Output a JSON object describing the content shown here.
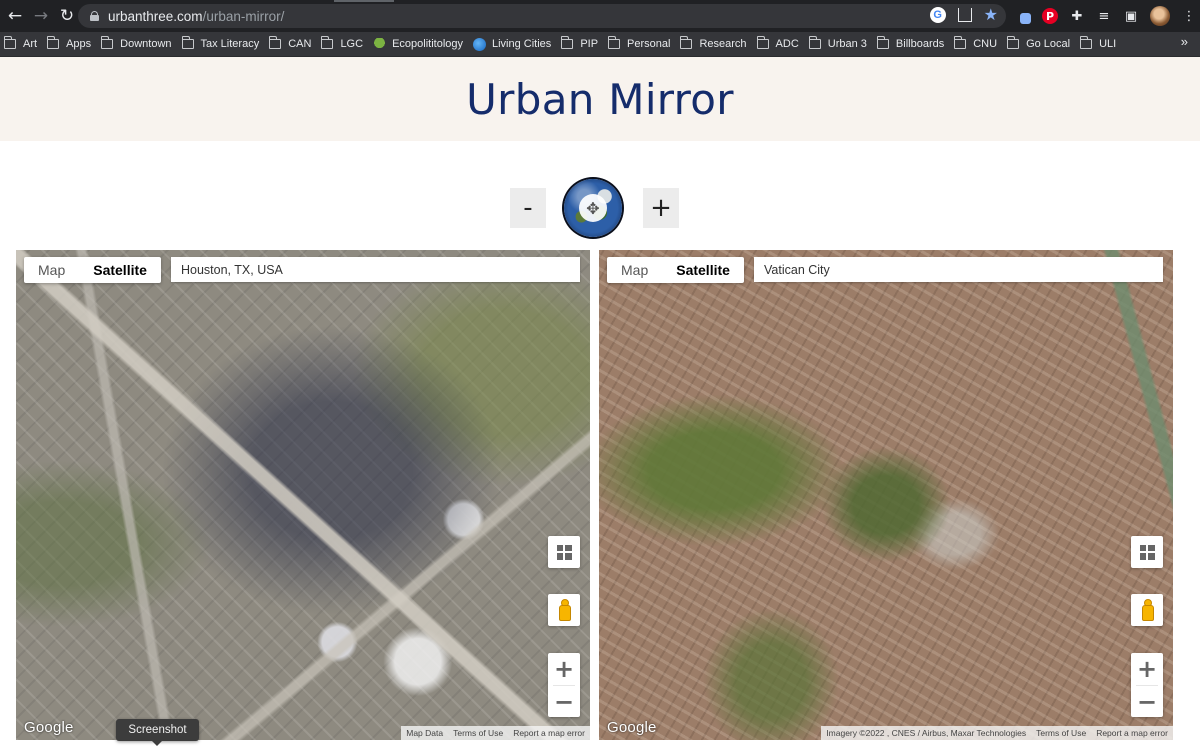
{
  "browser": {
    "url_host": "urbanthree.com",
    "url_path": "/urban-mirror/",
    "bookmarks": [
      "Art",
      "Apps",
      "Downtown",
      "Tax Literacy",
      "CAN",
      "LGC",
      "Ecopolititology",
      "Living Cities",
      "PIP",
      "Personal",
      "Research",
      "ADC",
      "Urban 3",
      "Billboards",
      "CNU",
      "Go Local",
      "ULI"
    ],
    "bookmarks_more": "»"
  },
  "page": {
    "title": "Urban Mirror",
    "zoom_out_label": "-",
    "zoom_in_label": "+"
  },
  "map_left": {
    "type_map": "Map",
    "type_satellite": "Satellite",
    "selected_type": "Satellite",
    "location": "Houston, TX, USA",
    "google_logo": "Google",
    "attrib_data": "Map Data",
    "attrib_terms": "Terms of Use",
    "attrib_report": "Report a map error"
  },
  "map_right": {
    "type_map": "Map",
    "type_satellite": "Satellite",
    "selected_type": "Satellite",
    "location": "Vatican City",
    "google_logo": "Google",
    "attrib_imagery": "Imagery ©2022 , CNES / Airbus, Maxar Technologies",
    "attrib_terms": "Terms of Use",
    "attrib_report": "Report a map error"
  },
  "tooltip": "Screenshot",
  "colors": {
    "title": "#152c6b",
    "hero_bg": "#f8f3ee",
    "chrome_bg": "#202124",
    "bookmark_bar_bg": "#35363a"
  }
}
